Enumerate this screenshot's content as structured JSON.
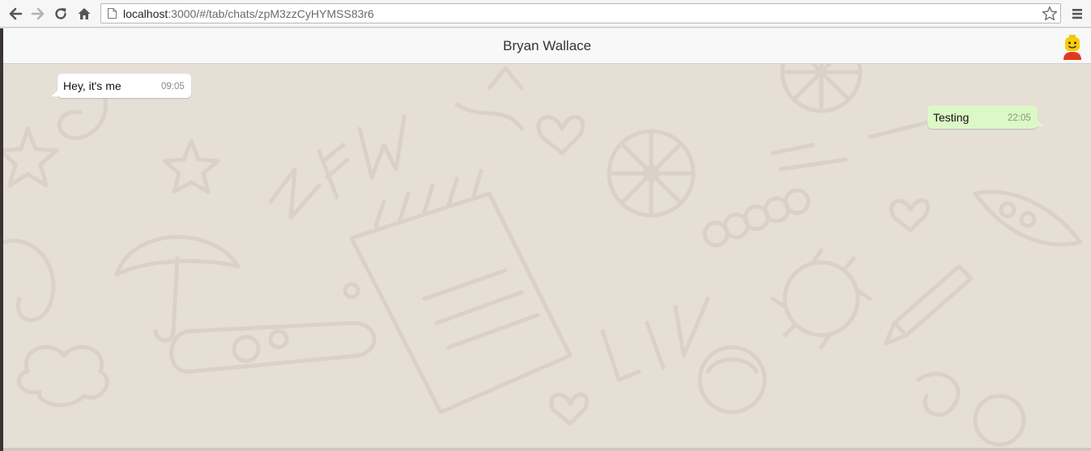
{
  "browser": {
    "url_host": "localhost",
    "url_path": ":3000/#/tab/chats/zpM3zzCyHYMSS83r6"
  },
  "header": {
    "title": "Bryan Wallace"
  },
  "messages": [
    {
      "direction": "incoming",
      "text": "Hey, it's me",
      "time": "09:05"
    },
    {
      "direction": "outgoing",
      "text": "Testing",
      "time": "22:05"
    }
  ],
  "colors": {
    "incoming_bubble": "#ffffff",
    "outgoing_bubble": "#dcf8c6",
    "chat_background": "#e6dfd6"
  },
  "icons": [
    "back-arrow-icon",
    "forward-arrow-icon",
    "reload-icon",
    "home-icon",
    "page-icon",
    "star-icon",
    "menu-icon",
    "lego-avatar-icon"
  ]
}
